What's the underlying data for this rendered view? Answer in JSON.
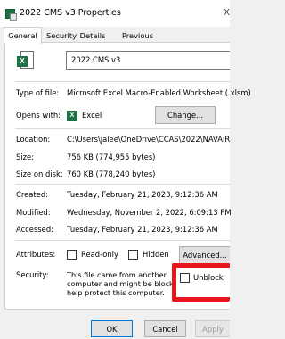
{
  "window": {
    "title": "2022 CMS v3 Properties",
    "close_glyph": "X"
  },
  "tabs": [
    {
      "label": "General"
    },
    {
      "label": "Security"
    },
    {
      "label": "Details"
    },
    {
      "label": "Previous Versions"
    }
  ],
  "file": {
    "name": "2022 CMS v3",
    "icon": "excel-file-icon"
  },
  "rows": {
    "type_label": "Type of file:",
    "type_value": "Microsoft Excel Macro-Enabled Worksheet (.xlsm)",
    "opens_label": "Opens with:",
    "opens_value": "Excel",
    "change_label": "Change...",
    "location_label": "Location:",
    "location_value": "C:\\Users\\jalee\\OneDrive\\CCAS\\2022\\NAVAIR",
    "size_label": "Size:",
    "size_value": "756 KB (774,955 bytes)",
    "size_on_disk_label": "Size on disk:",
    "size_on_disk_value": "760 KB (778,240 bytes)",
    "created_label": "Created:",
    "created_value": "Tuesday, February 21, 2023, 9:12:36 AM",
    "modified_label": "Modified:",
    "modified_value": "Wednesday, November 2, 2022, 6:09:13 PM",
    "accessed_label": "Accessed:",
    "accessed_value": "Tuesday, February 21, 2023, 9:12:36 AM",
    "attributes_label": "Attributes:",
    "readonly_label": "Read-only",
    "hidden_label": "Hidden",
    "advanced_label": "Advanced...",
    "security_label": "Security:",
    "security_line1": "This file came from another",
    "security_line2": "computer and might be blocked to",
    "security_line3": "help protect this computer.",
    "unblock_label": "Unblock"
  },
  "buttons": {
    "ok": "OK",
    "cancel": "Cancel",
    "apply": "Apply"
  },
  "colors": {
    "excel_green": "#1e7145",
    "highlight_red": "#e8141e"
  }
}
